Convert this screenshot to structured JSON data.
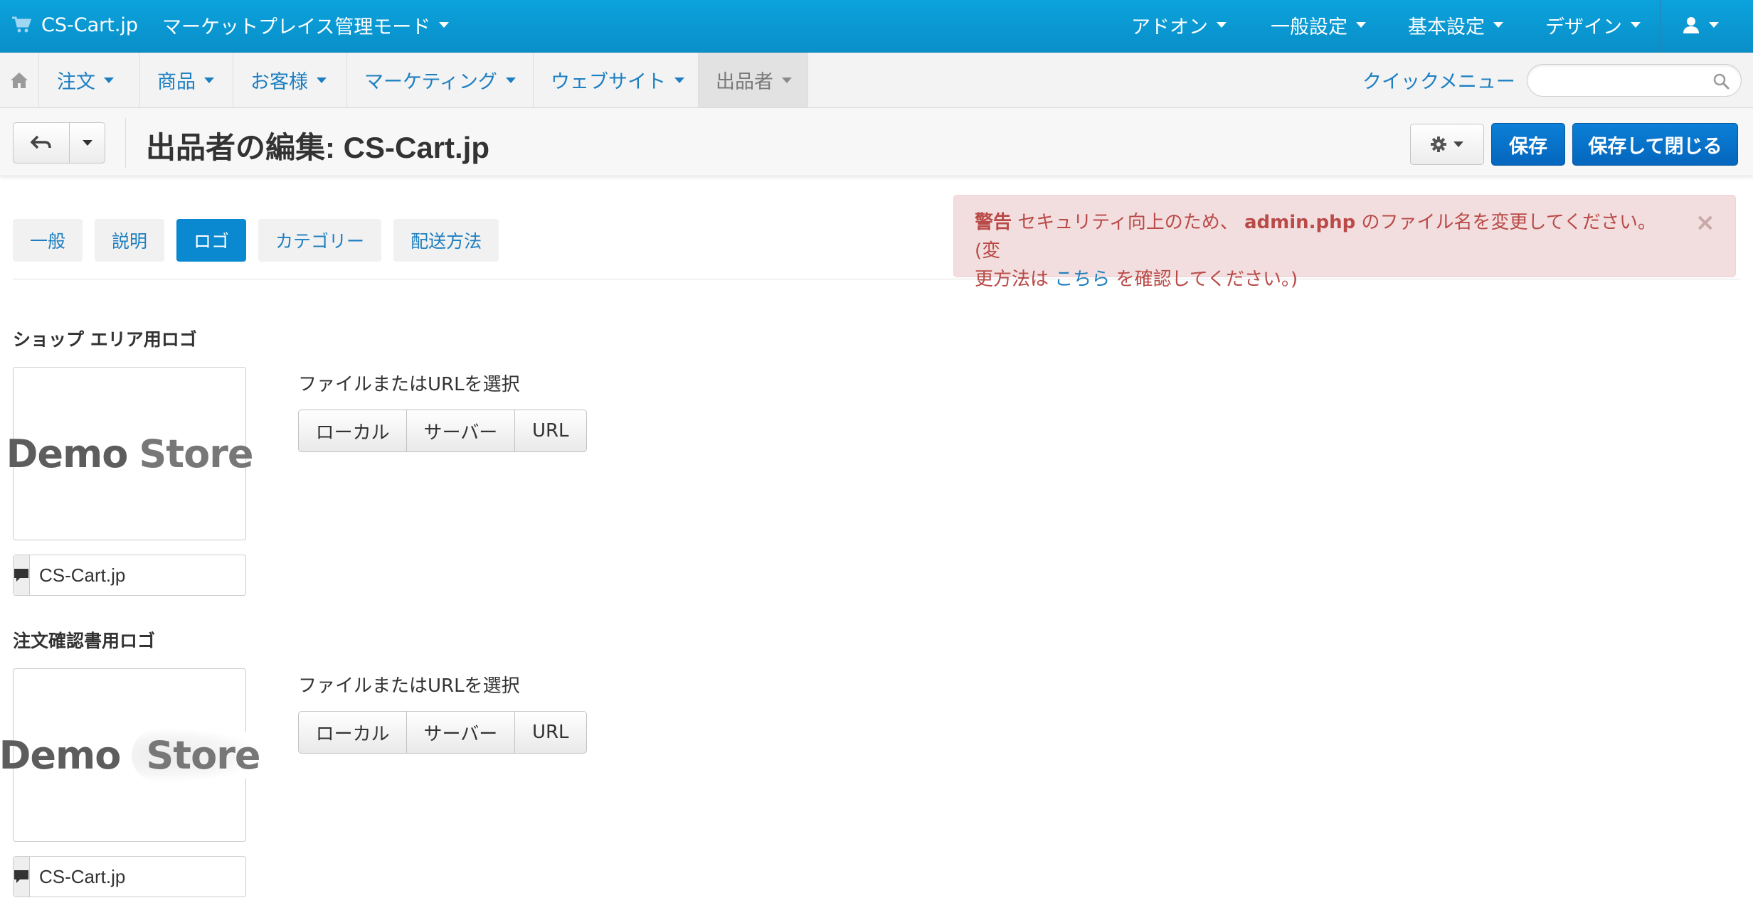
{
  "topbar": {
    "brand": "CS-Cart.jp",
    "mode": "マーケットプレイス管理モード",
    "menus": [
      "アドオン",
      "一般設定",
      "基本設定",
      "デザイン"
    ]
  },
  "nav": {
    "items": [
      "注文",
      "商品",
      "お客様",
      "マーケティング",
      "ウェブサイト",
      "出品者"
    ],
    "active": "出品者",
    "quick_menu": "クイックメニュー",
    "search_placeholder": ""
  },
  "header": {
    "title": "出品者の編集: CS-Cart.jp",
    "save": "保存",
    "save_close": "保存して閉じる"
  },
  "tabs": {
    "items": [
      "一般",
      "説明",
      "ロゴ",
      "カテゴリー",
      "配送方法"
    ],
    "active": "ロゴ"
  },
  "alert": {
    "label": "警告",
    "text1": "セキュリティ向上のため、",
    "file": "admin.php",
    "text2": "のファイル名を変更してください。(変",
    "text3": "更方法は",
    "link": "こちら",
    "text4": "を確認してください。)",
    "close": "×"
  },
  "logos": [
    {
      "title": "ショップ エリア用ロゴ",
      "image_word1": "Demo",
      "image_word2": "Store",
      "alt_text": "CS-Cart.jp",
      "picker_label": "ファイルまたはURLを選択",
      "buttons": [
        "ローカル",
        "サーバー",
        "URL"
      ]
    },
    {
      "title": "注文確認書用ロゴ",
      "image_word1": "Demo",
      "image_word2": "Store",
      "alt_text": "CS-Cart.jp",
      "picker_label": "ファイルまたはURLを選択",
      "buttons": [
        "ローカル",
        "サーバー",
        "URL"
      ]
    }
  ],
  "colors": {
    "topbar": "#0a9ad6",
    "link": "#1d7fc1",
    "primary": "#0566bd",
    "alert_bg": "#f2dede",
    "alert_text": "#b94a48"
  }
}
